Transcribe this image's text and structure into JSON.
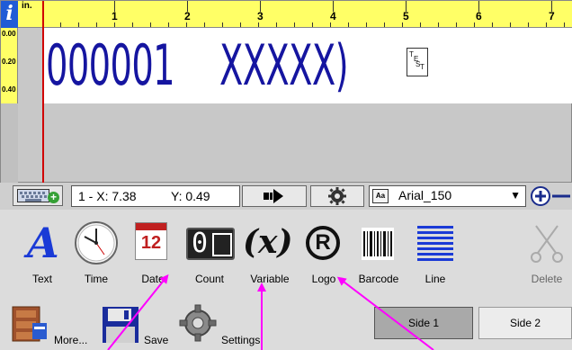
{
  "ruler": {
    "unit": "in.",
    "h_marks": [
      "1",
      "2",
      "3",
      "4",
      "5",
      "6",
      "7"
    ],
    "v_marks": [
      "0.00",
      "0.20",
      "0.40"
    ],
    "info_icon": "i"
  },
  "canvas": {
    "text1": "000001",
    "text2": "XXXXX)",
    "logo_letters": [
      "T",
      "E",
      "S",
      "T"
    ]
  },
  "toolbar": {
    "coord_x": "1 - X: 7.38",
    "coord_y": "Y: 0.49",
    "font_icon": "Aa",
    "font_name": "Arial_150",
    "icons": [
      "keyboard-add-icon",
      "arrow-right-icon",
      "gear-icon",
      "font-icon",
      "dropdown-icon",
      "zoom-icon"
    ]
  },
  "palette": {
    "text": "Text",
    "time": "Time",
    "date": "Date",
    "date_num": "12",
    "count": "Count",
    "count_glyph": "0",
    "variable": "Variable",
    "variable_glyph": "(x)",
    "logo": "Logo",
    "logo_glyph": "R",
    "barcode": "Barcode",
    "line": "Line",
    "delete": "Delete",
    "text_glyph": "A"
  },
  "bottom": {
    "more": "More...",
    "save": "Save",
    "settings": "Settings",
    "side1": "Side 1",
    "side2": "Side 2"
  },
  "colors": {
    "ruler": "#ffff66",
    "text_blue": "#1515a0",
    "arrow": "#ff00ff",
    "info": "#1f5bd6"
  }
}
